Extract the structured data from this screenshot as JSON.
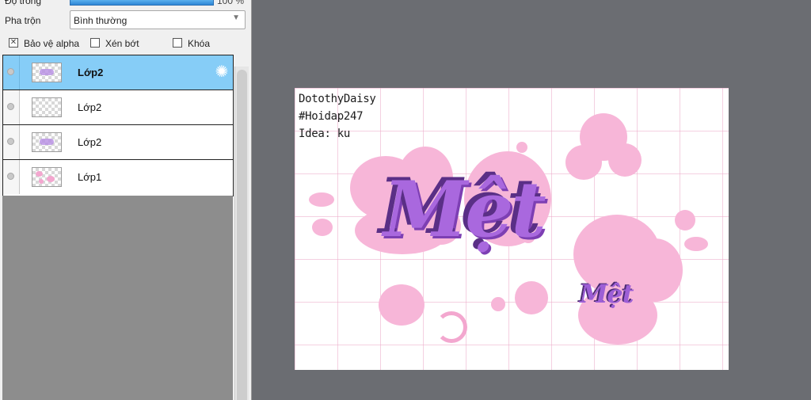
{
  "layer_panel": {
    "opacity": {
      "label": "Độ trong",
      "value_text": "100 %",
      "percent": 100
    },
    "blend": {
      "label": "Pha trộn",
      "value": "Bình thường"
    },
    "checkboxes": [
      {
        "label": "Bảo vệ alpha",
        "checked": true
      },
      {
        "label": "Xén bớt",
        "checked": false
      },
      {
        "label": "Khóa",
        "checked": false
      }
    ],
    "layers": [
      {
        "name": "Lớp2",
        "selected": true,
        "thumb": "lettering"
      },
      {
        "name": "Lớp2",
        "selected": false,
        "thumb": "empty"
      },
      {
        "name": "Lớp2",
        "selected": false,
        "thumb": "lettering"
      },
      {
        "name": "Lớp1",
        "selected": false,
        "thumb": "pink-blobs"
      }
    ],
    "icons": {
      "layer_settings": "gear-icon",
      "visibility": "visibility-dot-icon"
    }
  },
  "canvas": {
    "credit_lines": [
      "DotothyDaisy",
      "#Hoidap247",
      "Idea: ku"
    ],
    "main_word": "Mệt",
    "small_word": "Mệt",
    "colors": {
      "background": "#6b6d72",
      "selected_layer": "#86cdf7",
      "blob_pink": "#f7b6d8",
      "lettering_purple": "#a968de"
    }
  }
}
